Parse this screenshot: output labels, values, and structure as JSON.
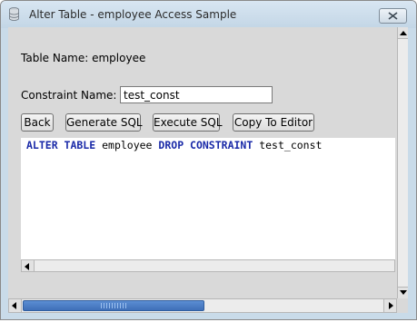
{
  "window": {
    "title": "Alter Table - employee Access Sample",
    "icons": {
      "app": "database-icon",
      "close": "close-x-icon"
    }
  },
  "form": {
    "table_name_label": "Table Name: employee",
    "constraint_label": "Constraint Name:",
    "constraint_value": "test_const"
  },
  "toolbar": {
    "back": "Back",
    "generate": "Generate SQL",
    "execute": "Execute SQL",
    "copy": "Copy To Editor"
  },
  "sql": {
    "kw1": "ALTER TABLE",
    "t1": " employee ",
    "kw2": "DROP CONSTRAINT",
    "t2": " test_const"
  },
  "colors": {
    "keyword": "#1a2aa8",
    "scroll_thumb": "#4a7cc6",
    "window_frame": "#c9dbe9",
    "panel": "#d9d9d9"
  },
  "scroll": {
    "outer_horizontal_thumb_fraction": 0.5
  }
}
